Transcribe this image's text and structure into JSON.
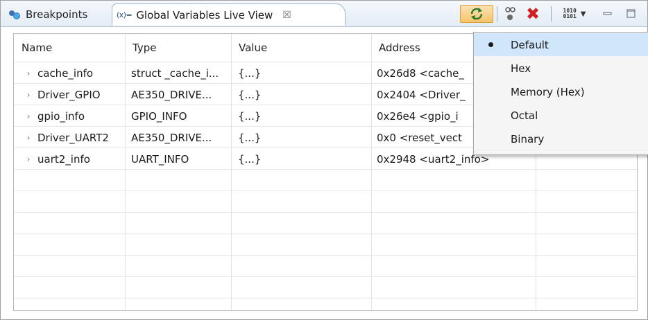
{
  "tabs": [
    {
      "label": "Breakpoints",
      "icon": "breakpoints-icon"
    },
    {
      "label": "Global Variables Live View",
      "icon": "variable-icon",
      "prefix": "(x)=",
      "close": "☒"
    }
  ],
  "toolbar": {
    "refresh_icon": "refresh-icon",
    "link_icon": "link-icon",
    "remove_icon": "remove-icon",
    "format_icon": "number-format-icon",
    "binary_top": "1010",
    "binary_bottom": "0101",
    "accent": "#f6c46a",
    "remove_color": "#d21f1f"
  },
  "table": {
    "columns": [
      "Name",
      "Type",
      "Value",
      "Address"
    ],
    "rows": [
      {
        "name": "cache_info",
        "type": "struct _cache_i...",
        "value": "{...}",
        "address": "0x26d8 <cache_"
      },
      {
        "name": "Driver_GPIO",
        "type": "AE350_DRIVE...",
        "value": "{...}",
        "address": "0x2404 <Driver_"
      },
      {
        "name": "gpio_info",
        "type": "GPIO_INFO",
        "value": "{...}",
        "address": "0x26e4 <gpio_i"
      },
      {
        "name": "Driver_UART2",
        "type": "AE350_DRIVE...",
        "value": "{...}",
        "address": "0x0 <reset_vect"
      },
      {
        "name": "uart2_info",
        "type": "UART_INFO",
        "value": "{...}",
        "address": "0x2948 <uart2_info>"
      }
    ],
    "expander": "›"
  },
  "format_menu": {
    "items": [
      "Default",
      "Hex",
      "Memory (Hex)",
      "Octal",
      "Binary"
    ],
    "selected": "Default",
    "highlight": "#cfe6fb"
  }
}
